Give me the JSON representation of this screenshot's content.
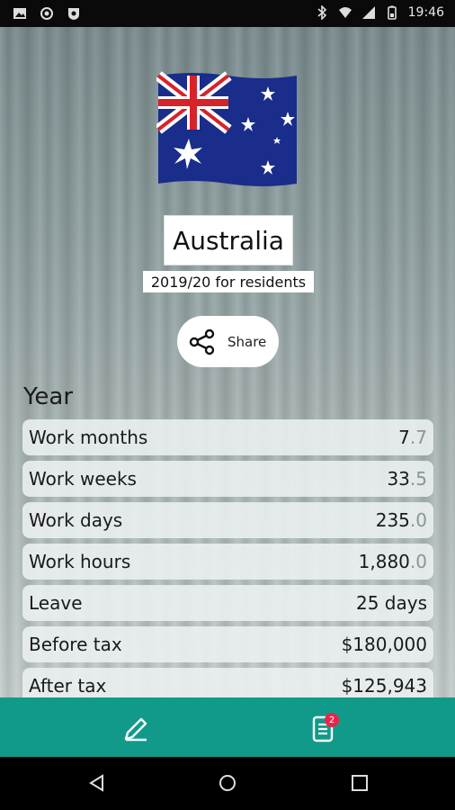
{
  "status_bar": {
    "time": "19:46",
    "left_icons": [
      "image-icon",
      "record-icon",
      "shield-icon"
    ],
    "right_icons": [
      "bluetooth-icon",
      "wifi-icon",
      "signal-icon",
      "battery-icon"
    ]
  },
  "header": {
    "flag": "australia-flag",
    "country": "Australia",
    "subtitle": "2019/20 for residents",
    "share_label": "Share"
  },
  "section": {
    "title": "Year",
    "rows": [
      {
        "label": "Work months",
        "value": "7.7"
      },
      {
        "label": "Work weeks",
        "value": "33.5"
      },
      {
        "label": "Work days",
        "value": "235.0"
      },
      {
        "label": "Work hours",
        "value": "1,880.0"
      },
      {
        "label": "Leave",
        "value": "25 days"
      },
      {
        "label": "Before tax",
        "value": "$180,000"
      },
      {
        "label": "After tax",
        "value": "$125,943"
      }
    ]
  },
  "bottom_nav": {
    "items": [
      {
        "icon": "pencil-icon"
      },
      {
        "icon": "document-icon",
        "badge": "2"
      }
    ],
    "color": "#119a8a"
  },
  "system_nav": {
    "buttons": [
      "back-icon",
      "home-icon",
      "recents-icon"
    ]
  }
}
